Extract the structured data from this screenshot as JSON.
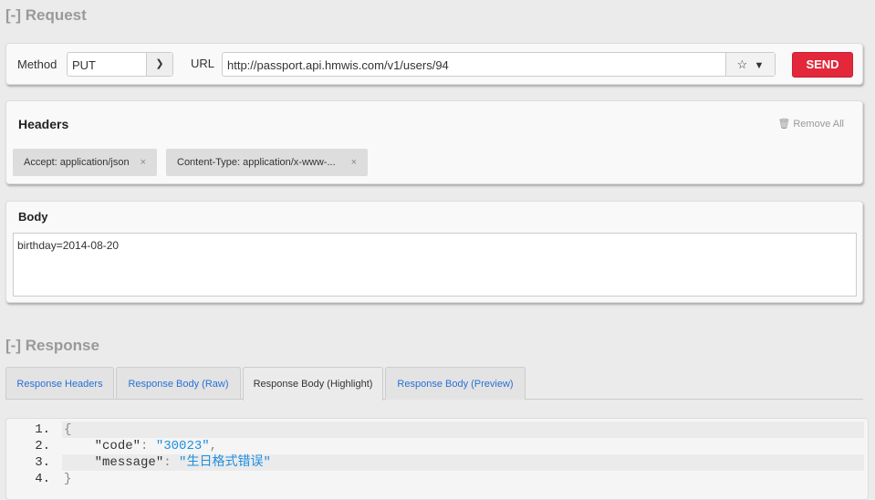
{
  "request": {
    "heading": "[-] Request",
    "method_label": "Method",
    "method_value": "PUT",
    "url_label": "URL",
    "url_value": "http://passport.api.hmwis.com/v1/users/94",
    "send_label": "SEND"
  },
  "headers": {
    "title": "Headers",
    "remove_all": "Remove All",
    "chips": [
      {
        "label": "Accept: application/json"
      },
      {
        "label": "Content-Type: application/x-www-..."
      }
    ]
  },
  "body": {
    "title": "Body",
    "value": "birthday=2014-08-20"
  },
  "response": {
    "heading": "[-] Response",
    "tabs": [
      {
        "label": "Response Headers"
      },
      {
        "label": "Response Body (Raw)"
      },
      {
        "label": "Response Body (Highlight)"
      },
      {
        "label": "Response Body (Preview)"
      }
    ],
    "active_tab": "Response Body (Highlight)",
    "lines": [
      {
        "n": "1.",
        "text": "{"
      },
      {
        "n": "2.",
        "key": "\"code\"",
        "value": "\"30023\""
      },
      {
        "n": "3.",
        "key": "\"message\"",
        "value": "\"生日格式错误\""
      },
      {
        "n": "4.",
        "text": "}"
      }
    ]
  }
}
